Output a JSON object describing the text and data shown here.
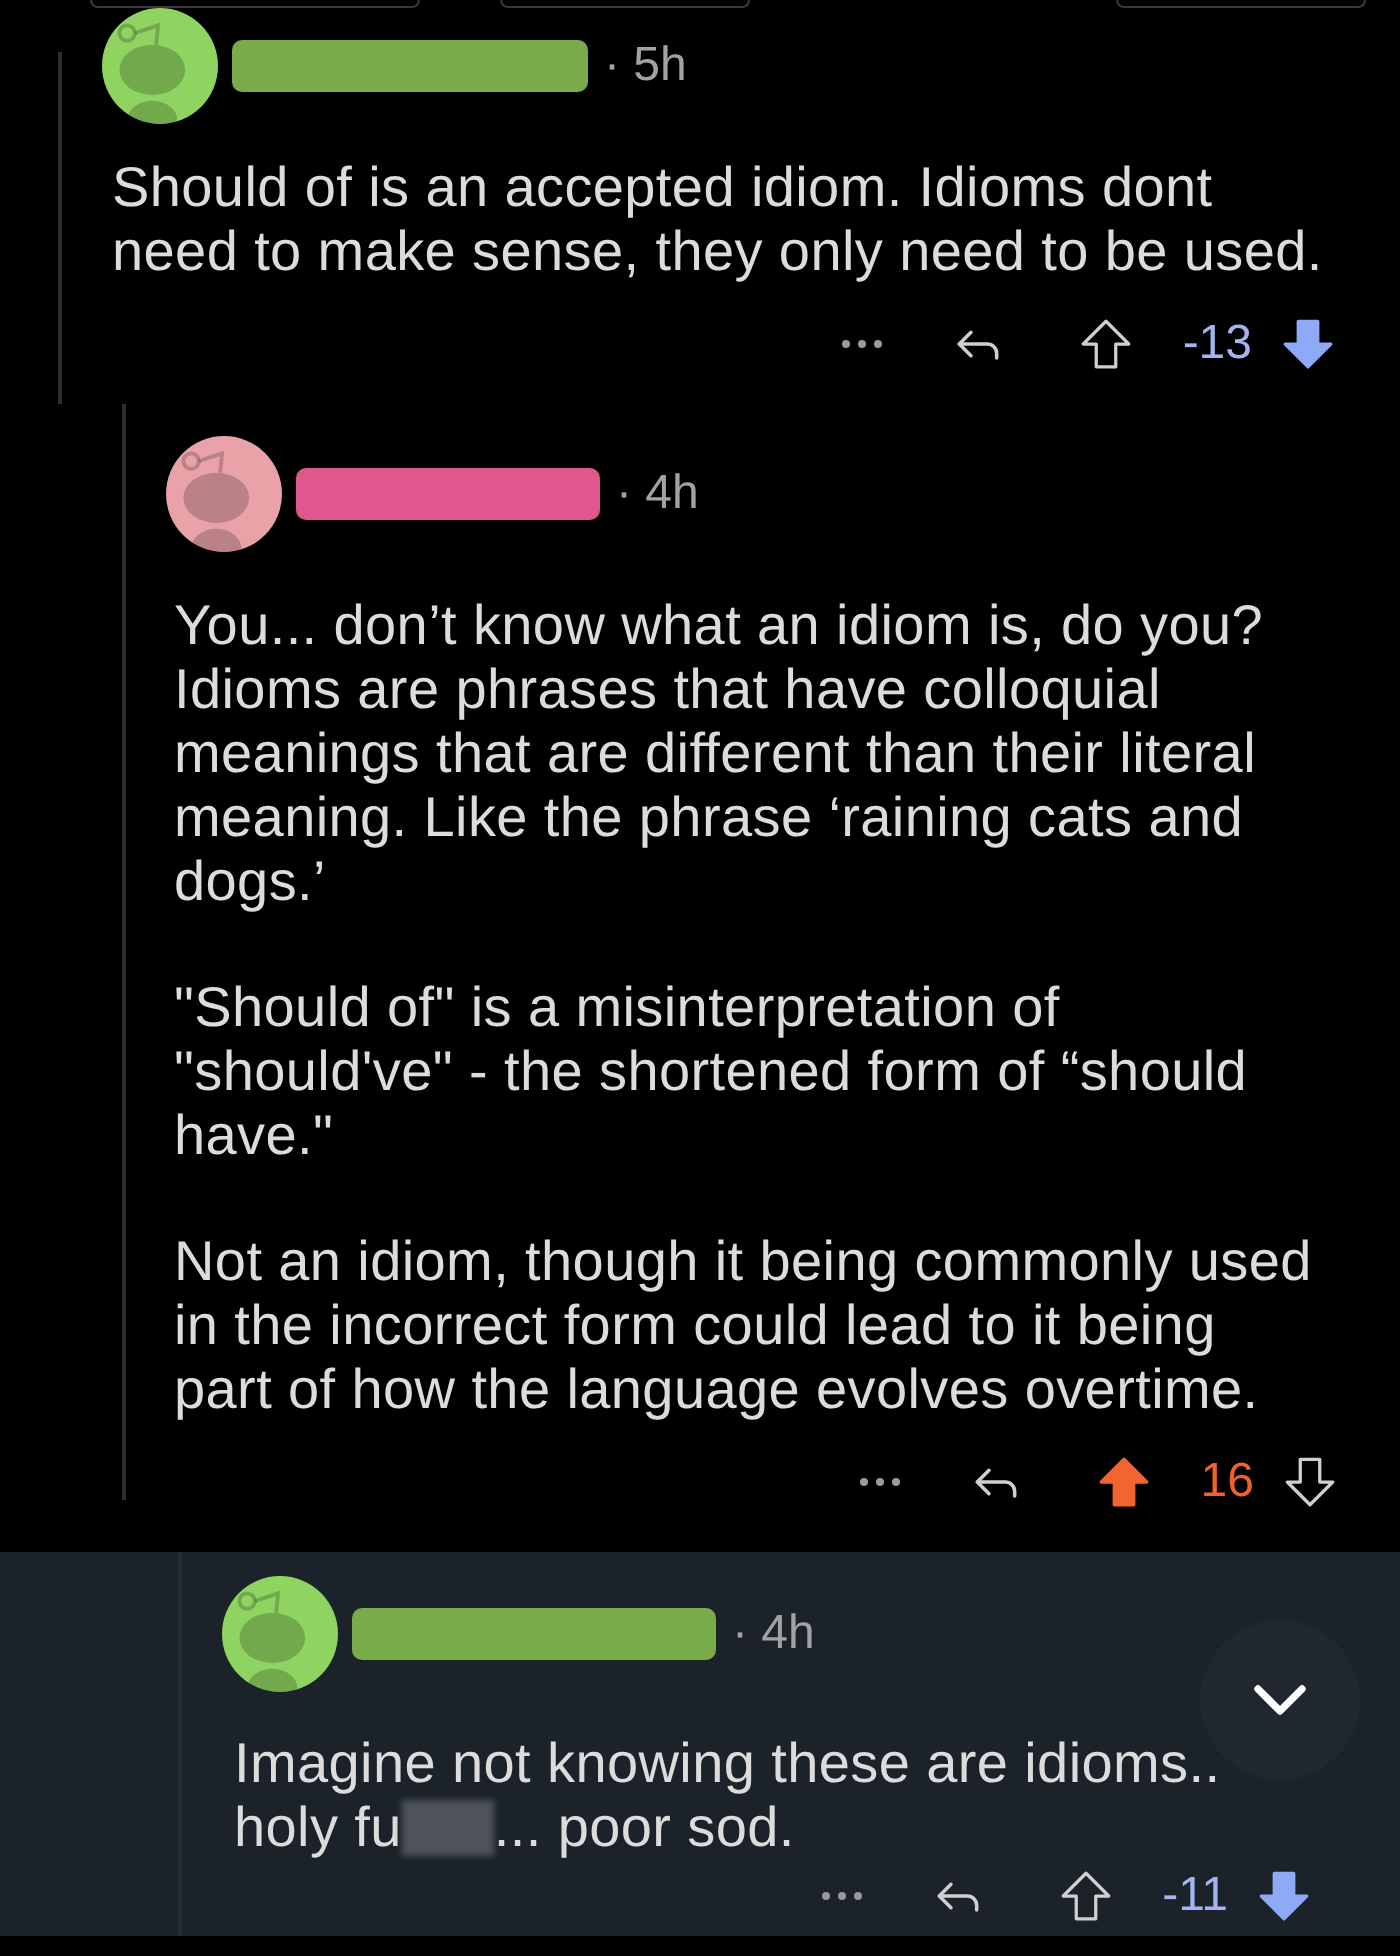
{
  "comments": [
    {
      "avatar": {
        "color": "#8fd461"
      },
      "redaction": {
        "color": "#7aab4b"
      },
      "time": "· 5h",
      "highlighted": false,
      "paragraphs": [
        [
          {
            "kind": "text",
            "text": "Should of is an accepted idiom. Idioms dont\nneed to make sense, they only need to be used."
          }
        ]
      ],
      "score": "-13",
      "upvoted": false,
      "downvoted": true,
      "children": [
        {
          "avatar": {
            "color": "#e9a3a8"
          },
          "redaction": {
            "color": "#e0578d"
          },
          "time": "· 4h",
          "highlighted": false,
          "paragraphs": [
            [
              {
                "kind": "text",
                "text": "You... don’t know what an idiom is, do you?\nIdioms are phrases that have colloquial\nmeanings that are different than their literal\nmeaning. Like the phrase ‘raining cats and\ndogs.’"
              }
            ],
            [
              {
                "kind": "text",
                "text": "\"Should of\" is a misinterpretation of\n\"should've\" - the shortened form of “should\nhave.\""
              }
            ],
            [
              {
                "kind": "text",
                "text": "Not an idiom, though it being commonly used\nin the incorrect form could lead to it being\npart of how the language evolves overtime."
              }
            ]
          ],
          "score": "16",
          "upvoted": true,
          "downvoted": false,
          "children": [
            {
              "avatar": {
                "color": "#8fd461"
              },
              "redaction": {
                "color": "#7aab4b"
              },
              "time": "· 4h",
              "highlighted": true,
              "paragraphs": [
                [
                  {
                    "kind": "text",
                    "text": "Imagine not knowing these are idioms..\nholy fu"
                  },
                  {
                    "kind": "censor"
                  },
                  {
                    "kind": "text",
                    "text": "... poor sod."
                  }
                ]
              ],
              "score": "-11",
              "upvoted": false,
              "downvoted": true
            }
          ]
        }
      ]
    }
  ]
}
